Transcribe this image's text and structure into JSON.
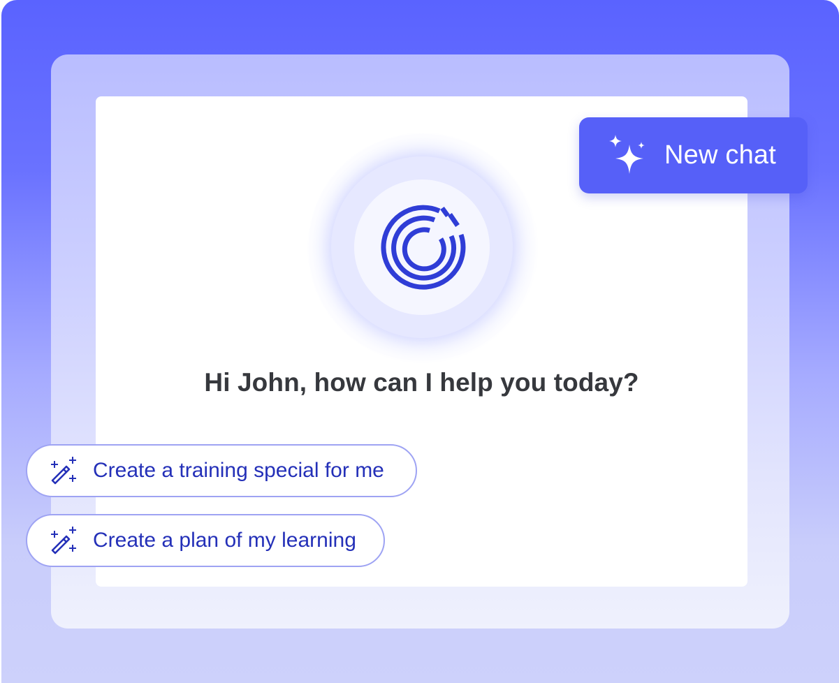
{
  "new_chat_button": {
    "label": "New chat",
    "icon": "sparkles-icon"
  },
  "assistant_logo": {
    "icon": "assistant-logo-icon"
  },
  "greeting": "Hi John, how can I help you today?",
  "suggestions": [
    {
      "label": "Create a training special for me",
      "icon": "magic-wand-icon"
    },
    {
      "label": "Create a plan of my learning",
      "icon": "magic-wand-icon"
    }
  ],
  "colors": {
    "primary": "#5660f8",
    "logo_blue": "#2f3dd6",
    "suggestion_text": "#2430b8",
    "suggestion_border": "#9ea3f3",
    "greeting_text": "#36383d"
  }
}
